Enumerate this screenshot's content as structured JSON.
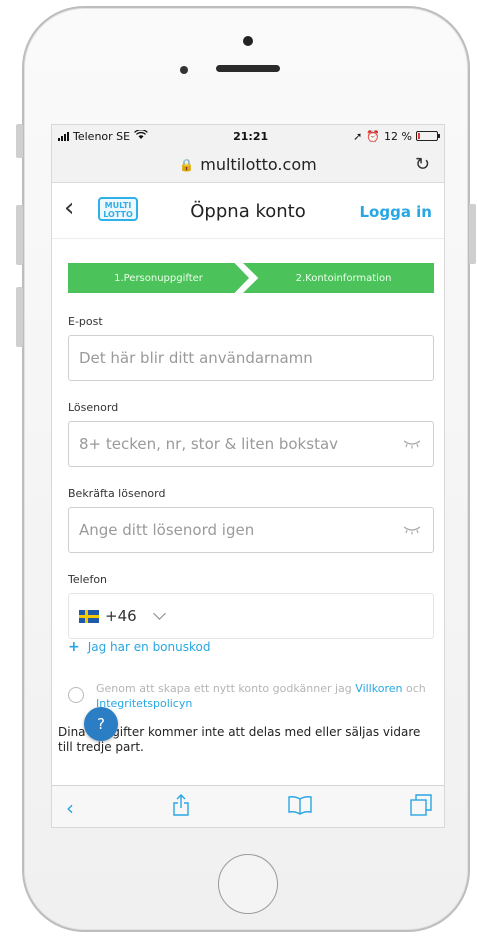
{
  "status_bar": {
    "carrier": "Telenor SE",
    "time": "21:21",
    "battery": "12 %",
    "battery_level": 0.12
  },
  "browser": {
    "url": "multilotto.com"
  },
  "header": {
    "title": "Öppna konto",
    "login_label": "Logga in",
    "logo_text_1": "MULTI",
    "logo_text_2": "LOTTO"
  },
  "steps": [
    {
      "label": "1.Personuppgifter"
    },
    {
      "label": "2.Kontoinformation"
    }
  ],
  "form": {
    "email": {
      "label": "E-post",
      "placeholder": "Det här blir ditt användarnamn"
    },
    "password": {
      "label": "Lösenord",
      "placeholder": "8+ tecken, nr, stor & liten bokstav"
    },
    "confirm": {
      "label": "Bekräfta lösenord",
      "placeholder": "Ange ditt lösenord igen"
    },
    "phone": {
      "label": "Telefon",
      "country_code": "+46"
    }
  },
  "bonus": {
    "label": "Jag har en bonuskod"
  },
  "consent": {
    "text_start": "Genom att skapa ett nytt konto godkänner jag",
    "terms_link": "Villkoren",
    "and": "och",
    "privacy_link": "Integritetspolicyn"
  },
  "privacy_note": "Dina uppgifter kommer inte att delas med eller säljas vidare till tredje part.",
  "help": {
    "label": "?"
  },
  "colors": {
    "accent": "#27a7e3",
    "step_green": "#4cc35a",
    "help_blue": "#2b7dc4"
  }
}
